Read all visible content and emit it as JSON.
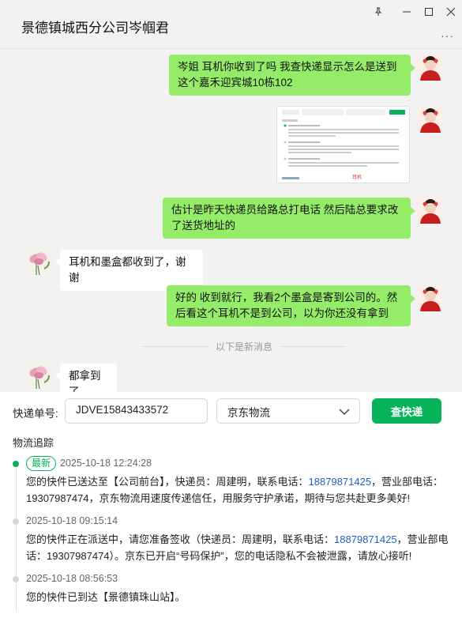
{
  "window": {
    "title": "景德镇城西分公司岑帼君",
    "more": "···"
  },
  "chat": {
    "messages": [
      {
        "text": "岑姐  耳机你收到了吗 我查快递显示怎么是送到这个嘉禾迎宾城10栋102"
      },
      {
        "text": "估计是昨天快递员给路总打电话  然后陆总要求改了送货地址的"
      },
      {
        "text": "耳机和墨盒都收到了，谢谢"
      },
      {
        "text": "好的  收到就行，我看2个墨盒是寄到公司的。然后看这个耳机不是到公司，以为你还没有拿到"
      },
      {
        "text": "都拿到了"
      }
    ],
    "new_divider": "以下是新消息",
    "image_caption": "耳机"
  },
  "tracking": {
    "label": "快递单号:",
    "number": "JDVE15843433572",
    "carrier": "京东物流",
    "query_label": "查快递",
    "section_title": "物流追踪",
    "latest_badge": "最新",
    "events": [
      {
        "time": "2025-10-18 12:24:28",
        "pre": "您的快件已送达至【公司前台】，快递员：周建明，联系电话：",
        "phone": "18879871425",
        "post": "，营业部电话：19307987474，京东物流用速度传递信任，用服务守护承诺，期待与您共赴更多美好!"
      },
      {
        "time": "2025-10-18 09:15:14",
        "pre": "您的快件正在派送中，请您准备签收（快递员：周建明，联系电话：",
        "phone": "18879871425",
        "post": "，营业部电话：19307987474）。京东已开启“号码保护”，您的电话隐私不会被泄露，请放心接听!"
      },
      {
        "time": "2025-10-18 08:56:53",
        "pre": "您的快件已到达【景德镇珠山站】。",
        "phone": "",
        "post": ""
      }
    ]
  },
  "colors": {
    "bubble_mine": "#95ec69",
    "accent": "#07b35a",
    "phone_link": "#1f5fbf"
  },
  "icons": {
    "pin": "pin-icon",
    "minimize": "minimize-icon",
    "maximize": "maximize-icon",
    "close": "close-icon",
    "dropdown": "chevron-down-icon"
  }
}
